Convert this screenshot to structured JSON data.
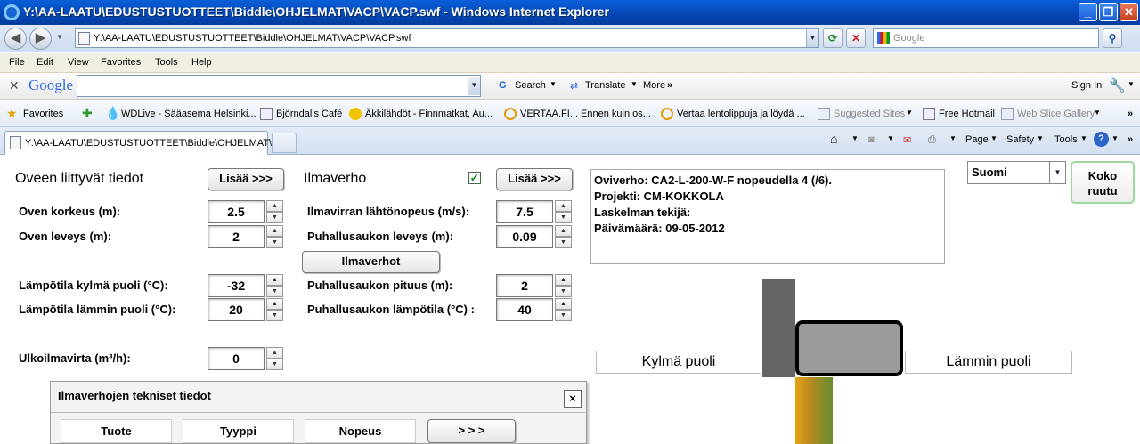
{
  "window": {
    "title": "Y:\\AA-LAATU\\EDUSTUSTUOTTEET\\Biddle\\OHJELMAT\\VACP\\VACP.swf - Windows Internet Explorer",
    "minimize": "_",
    "maximize": "❐",
    "close": "✕"
  },
  "address": {
    "url": "Y:\\AA-LAATU\\EDUSTUSTUOTTEET\\Biddle\\OHJELMAT\\VACP\\VACP.swf",
    "search_placeholder": "Google"
  },
  "menu": [
    "File",
    "Edit",
    "View",
    "Favorites",
    "Tools",
    "Help"
  ],
  "google_toolbar": {
    "logo": "Google",
    "search": "Search",
    "translate": "Translate",
    "more": "More",
    "sign_in": "Sign In"
  },
  "favorites": {
    "label": "Favorites",
    "items": [
      "WDLive - Sääasema Helsinki...",
      "Björndal's Café",
      "Äkkilähdöt - Finnmatkat, Au...",
      "VERTAA.FI... Ennen kuin os...",
      "Vertaa lentolippuja ja löydä ...",
      "Suggested Sites",
      "Free Hotmail",
      "Web Slice Gallery"
    ]
  },
  "tabs": {
    "active": "Y:\\AA-LAATU\\EDUSTUSTUOTTEET\\Biddle\\OHJELMAT\\...",
    "commands": [
      "Page",
      "Safety",
      "Tools"
    ]
  },
  "app": {
    "door_header": "Oveen liittyvät tiedot",
    "add_button": "Lisää >>>",
    "curtain_header": "Ilmaverho",
    "curtain_checked": true,
    "fields_left": [
      {
        "label": "Oven korkeus (m):",
        "value": "2.5"
      },
      {
        "label": "Oven leveys (m):",
        "value": "2"
      },
      {
        "label": "Lämpötila kylmä puoli (°C):",
        "value": "-32"
      },
      {
        "label": "Lämpötila lämmin puoli (°C):",
        "value": "20"
      },
      {
        "label": "Ulkoilmavirta (m³/h):",
        "value": "0"
      }
    ],
    "fields_right": [
      {
        "label": "Ilmavirran lähtönopeus (m/s):",
        "value": "7.5"
      },
      {
        "label": "Puhallusaukon leveys (m):",
        "value": "0.09"
      },
      {
        "label": "Puhallusaukon pituus (m):",
        "value": "2"
      },
      {
        "label": "Puhallusaukon lämpötila (°C) :",
        "value": "40"
      }
    ],
    "curtains_button": "Ilmaverhot",
    "info_lines": [
      "Oviverho: CA2-L-200-W-F  nopeudella 4 (/6).",
      "Projekti: CM-KOKKOLA",
      "Laskelman tekijä:",
      "Päivämäärä: 09-05-2012"
    ],
    "language": "Suomi",
    "fullscreen": "Koko ruutu",
    "cold_side": "Kylmä puoli",
    "warm_side": "Lämmin puoli",
    "panel": {
      "title": "Ilmaverhojen tekniset tiedot",
      "close": "×",
      "columns": [
        "Tuote",
        "Tyyppi",
        "Nopeus"
      ],
      "next": "> > >"
    }
  }
}
